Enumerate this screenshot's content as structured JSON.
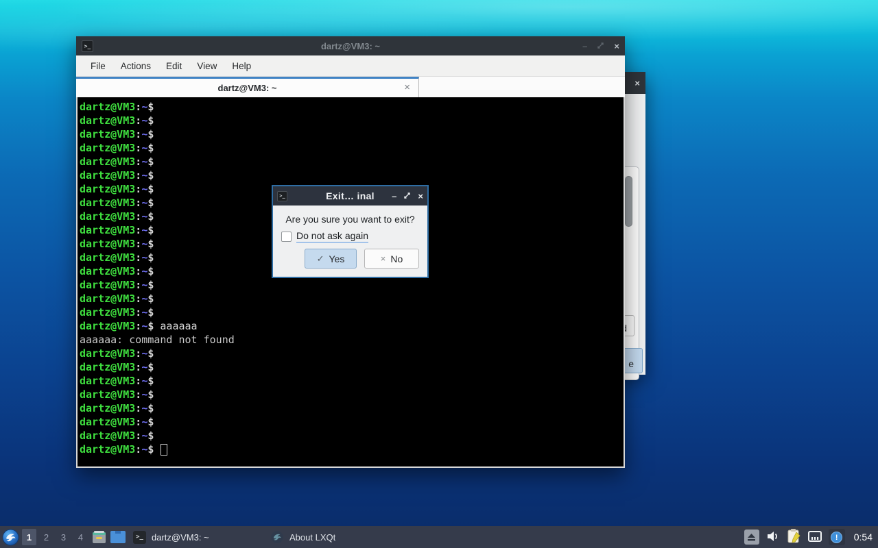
{
  "colors": {
    "accent_tab": "#4183c4",
    "titlebar": "#2f343a",
    "taskbar": "#353b4b",
    "terminal_green": "#3fdf3f",
    "terminal_path_blue": "#6e6ef0",
    "dialog_border": "#2e6da4",
    "yes_button_bg": "#c5daee",
    "wallpaper_top": "#23dbe6",
    "wallpaper_bottom": "#0a2b66"
  },
  "terminal_window": {
    "title": "dartz@VM3: ~",
    "controls": {
      "minimize": "–",
      "close": "×"
    },
    "menu": [
      "File",
      "Actions",
      "Edit",
      "View",
      "Help"
    ],
    "tab": {
      "title": "dartz@VM3: ~",
      "close": "×"
    },
    "prompt": {
      "user": "dartz@VM3",
      "sep": ":",
      "path": "~",
      "sign": "$"
    },
    "lines": [
      {
        "t": "p"
      },
      {
        "t": "p"
      },
      {
        "t": "p"
      },
      {
        "t": "p"
      },
      {
        "t": "p"
      },
      {
        "t": "p"
      },
      {
        "t": "p"
      },
      {
        "t": "p"
      },
      {
        "t": "p"
      },
      {
        "t": "p"
      },
      {
        "t": "p"
      },
      {
        "t": "p"
      },
      {
        "t": "p"
      },
      {
        "t": "p"
      },
      {
        "t": "p"
      },
      {
        "t": "p"
      },
      {
        "t": "p",
        "cmd": "aaaaaa"
      },
      {
        "t": "o",
        "text": "aaaaaa: command not found"
      },
      {
        "t": "p"
      },
      {
        "t": "p"
      },
      {
        "t": "p"
      },
      {
        "t": "p"
      },
      {
        "t": "p"
      },
      {
        "t": "p"
      },
      {
        "t": "p"
      },
      {
        "t": "p",
        "cursor": true
      }
    ]
  },
  "dialog": {
    "title": "Exit… inal",
    "controls": {
      "minimize": "–",
      "close": "×"
    },
    "message": "Are you sure you want to exit?",
    "checkbox_label": "Do not ask again",
    "yes_icon": "✓",
    "yes_label": "Yes",
    "no_icon": "×",
    "no_label": "No"
  },
  "about_window": {
    "close": "×",
    "button_fragment_top": "d",
    "button_fragment_bottom": "e"
  },
  "taskbar": {
    "workspaces": [
      "1",
      "2",
      "3",
      "4"
    ],
    "active_workspace": "1",
    "tasks": [
      {
        "label": "dartz@VM3: ~"
      },
      {
        "label": "About LXQt"
      }
    ],
    "clock": "0:54"
  }
}
